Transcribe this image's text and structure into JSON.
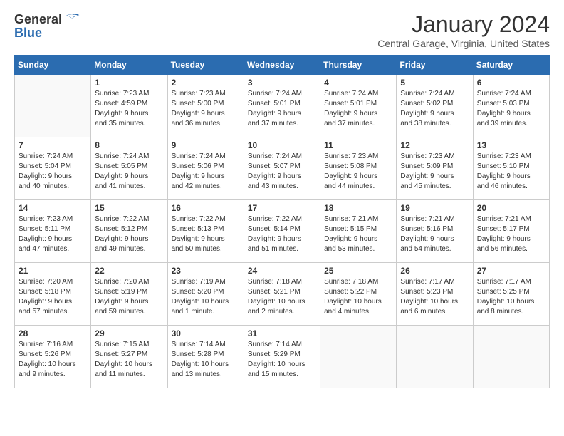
{
  "header": {
    "logo_general": "General",
    "logo_blue": "Blue",
    "month_title": "January 2024",
    "location": "Central Garage, Virginia, United States"
  },
  "weekdays": [
    "Sunday",
    "Monday",
    "Tuesday",
    "Wednesday",
    "Thursday",
    "Friday",
    "Saturday"
  ],
  "weeks": [
    [
      {
        "day": "",
        "info": ""
      },
      {
        "day": "1",
        "info": "Sunrise: 7:23 AM\nSunset: 4:59 PM\nDaylight: 9 hours\nand 35 minutes."
      },
      {
        "day": "2",
        "info": "Sunrise: 7:23 AM\nSunset: 5:00 PM\nDaylight: 9 hours\nand 36 minutes."
      },
      {
        "day": "3",
        "info": "Sunrise: 7:24 AM\nSunset: 5:01 PM\nDaylight: 9 hours\nand 37 minutes."
      },
      {
        "day": "4",
        "info": "Sunrise: 7:24 AM\nSunset: 5:01 PM\nDaylight: 9 hours\nand 37 minutes."
      },
      {
        "day": "5",
        "info": "Sunrise: 7:24 AM\nSunset: 5:02 PM\nDaylight: 9 hours\nand 38 minutes."
      },
      {
        "day": "6",
        "info": "Sunrise: 7:24 AM\nSunset: 5:03 PM\nDaylight: 9 hours\nand 39 minutes."
      }
    ],
    [
      {
        "day": "7",
        "info": "Sunrise: 7:24 AM\nSunset: 5:04 PM\nDaylight: 9 hours\nand 40 minutes."
      },
      {
        "day": "8",
        "info": "Sunrise: 7:24 AM\nSunset: 5:05 PM\nDaylight: 9 hours\nand 41 minutes."
      },
      {
        "day": "9",
        "info": "Sunrise: 7:24 AM\nSunset: 5:06 PM\nDaylight: 9 hours\nand 42 minutes."
      },
      {
        "day": "10",
        "info": "Sunrise: 7:24 AM\nSunset: 5:07 PM\nDaylight: 9 hours\nand 43 minutes."
      },
      {
        "day": "11",
        "info": "Sunrise: 7:23 AM\nSunset: 5:08 PM\nDaylight: 9 hours\nand 44 minutes."
      },
      {
        "day": "12",
        "info": "Sunrise: 7:23 AM\nSunset: 5:09 PM\nDaylight: 9 hours\nand 45 minutes."
      },
      {
        "day": "13",
        "info": "Sunrise: 7:23 AM\nSunset: 5:10 PM\nDaylight: 9 hours\nand 46 minutes."
      }
    ],
    [
      {
        "day": "14",
        "info": "Sunrise: 7:23 AM\nSunset: 5:11 PM\nDaylight: 9 hours\nand 47 minutes."
      },
      {
        "day": "15",
        "info": "Sunrise: 7:22 AM\nSunset: 5:12 PM\nDaylight: 9 hours\nand 49 minutes."
      },
      {
        "day": "16",
        "info": "Sunrise: 7:22 AM\nSunset: 5:13 PM\nDaylight: 9 hours\nand 50 minutes."
      },
      {
        "day": "17",
        "info": "Sunrise: 7:22 AM\nSunset: 5:14 PM\nDaylight: 9 hours\nand 51 minutes."
      },
      {
        "day": "18",
        "info": "Sunrise: 7:21 AM\nSunset: 5:15 PM\nDaylight: 9 hours\nand 53 minutes."
      },
      {
        "day": "19",
        "info": "Sunrise: 7:21 AM\nSunset: 5:16 PM\nDaylight: 9 hours\nand 54 minutes."
      },
      {
        "day": "20",
        "info": "Sunrise: 7:21 AM\nSunset: 5:17 PM\nDaylight: 9 hours\nand 56 minutes."
      }
    ],
    [
      {
        "day": "21",
        "info": "Sunrise: 7:20 AM\nSunset: 5:18 PM\nDaylight: 9 hours\nand 57 minutes."
      },
      {
        "day": "22",
        "info": "Sunrise: 7:20 AM\nSunset: 5:19 PM\nDaylight: 9 hours\nand 59 minutes."
      },
      {
        "day": "23",
        "info": "Sunrise: 7:19 AM\nSunset: 5:20 PM\nDaylight: 10 hours\nand 1 minute."
      },
      {
        "day": "24",
        "info": "Sunrise: 7:18 AM\nSunset: 5:21 PM\nDaylight: 10 hours\nand 2 minutes."
      },
      {
        "day": "25",
        "info": "Sunrise: 7:18 AM\nSunset: 5:22 PM\nDaylight: 10 hours\nand 4 minutes."
      },
      {
        "day": "26",
        "info": "Sunrise: 7:17 AM\nSunset: 5:23 PM\nDaylight: 10 hours\nand 6 minutes."
      },
      {
        "day": "27",
        "info": "Sunrise: 7:17 AM\nSunset: 5:25 PM\nDaylight: 10 hours\nand 8 minutes."
      }
    ],
    [
      {
        "day": "28",
        "info": "Sunrise: 7:16 AM\nSunset: 5:26 PM\nDaylight: 10 hours\nand 9 minutes."
      },
      {
        "day": "29",
        "info": "Sunrise: 7:15 AM\nSunset: 5:27 PM\nDaylight: 10 hours\nand 11 minutes."
      },
      {
        "day": "30",
        "info": "Sunrise: 7:14 AM\nSunset: 5:28 PM\nDaylight: 10 hours\nand 13 minutes."
      },
      {
        "day": "31",
        "info": "Sunrise: 7:14 AM\nSunset: 5:29 PM\nDaylight: 10 hours\nand 15 minutes."
      },
      {
        "day": "",
        "info": ""
      },
      {
        "day": "",
        "info": ""
      },
      {
        "day": "",
        "info": ""
      }
    ]
  ]
}
